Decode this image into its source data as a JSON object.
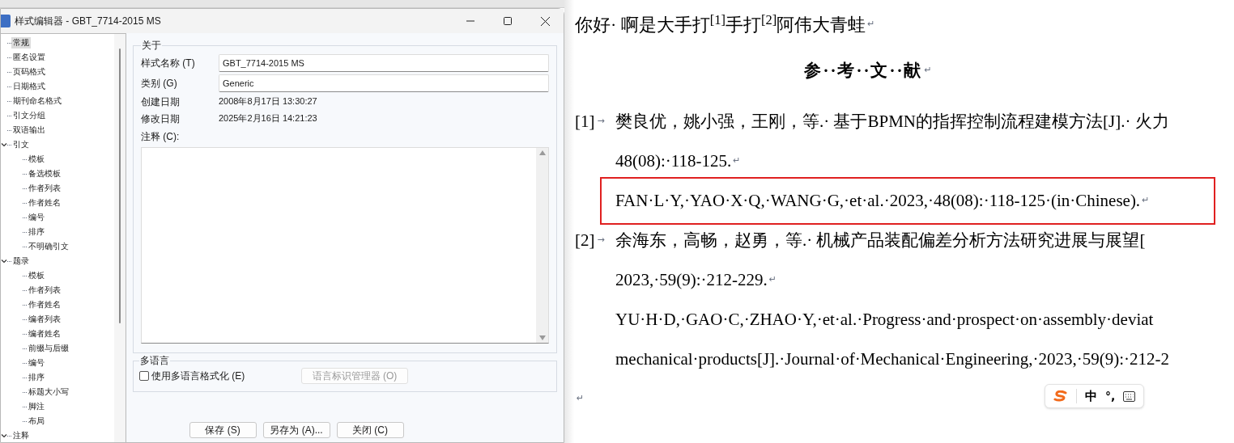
{
  "dialog": {
    "title": "样式编辑器 - GBT_7714-2015 MS",
    "tree": [
      {
        "label": "常规",
        "selected": true
      },
      {
        "label": "匿名设置",
        "selected": false
      },
      {
        "label": "页码格式",
        "selected": false
      },
      {
        "label": "日期格式",
        "selected": false
      },
      {
        "label": "期刊命名格式",
        "selected": false
      },
      {
        "label": "引文分组",
        "selected": false
      },
      {
        "label": "双语输出",
        "selected": false
      },
      {
        "label": "引文",
        "selected": false,
        "expanded": true,
        "children": [
          {
            "label": "模板",
            "selected": false
          },
          {
            "label": "备选模板",
            "selected": false
          },
          {
            "label": "作者列表",
            "selected": false
          },
          {
            "label": "作者姓名",
            "selected": false
          },
          {
            "label": "编号",
            "selected": false
          },
          {
            "label": "排序",
            "selected": false
          },
          {
            "label": "不明确引文",
            "selected": false
          }
        ]
      },
      {
        "label": "题录",
        "selected": false,
        "expanded": true,
        "children": [
          {
            "label": "模板",
            "selected": false
          },
          {
            "label": "作者列表",
            "selected": false
          },
          {
            "label": "作者姓名",
            "selected": false
          },
          {
            "label": "编者列表",
            "selected": false
          },
          {
            "label": "编者姓名",
            "selected": false
          },
          {
            "label": "前缀与后缀",
            "selected": false
          },
          {
            "label": "编号",
            "selected": false
          },
          {
            "label": "排序",
            "selected": false
          },
          {
            "label": "标题大小写",
            "selected": false
          },
          {
            "label": "脚注",
            "selected": false
          },
          {
            "label": "布局",
            "selected": false
          }
        ]
      },
      {
        "label": "注释",
        "selected": false,
        "expanded": true
      }
    ],
    "about": {
      "legend": "关于",
      "fields": [
        {
          "label": "样式名称 (T)",
          "value": "GBT_7714-2015 MS"
        },
        {
          "label": "类别 (G)",
          "value": "Generic"
        }
      ],
      "info": [
        {
          "label": "创建日期",
          "value": "2008年8月17日 13:30:27"
        },
        {
          "label": "修改日期",
          "value": "2025年2月16日 14:21:23"
        }
      ],
      "notes_label": "注释 (C):"
    },
    "multilang": {
      "legend": "多语言",
      "checkbox": {
        "label": "使用多语言格式化 (E)",
        "checked": false
      },
      "button": {
        "label": "语言标识管理器 (O)",
        "disabled": true
      }
    },
    "buttons": [
      "保存 (S)",
      "另存为 (A)...",
      "关闭 (C)"
    ]
  },
  "document": {
    "paragraphs": [
      {
        "kind": "text",
        "text": "你好· 啊是大手打$^{[1]}$手打$^{[2]}$阿伟大青蛙",
        "mark": "↵"
      },
      {
        "kind": "heading",
        "text": "参··考··文··献",
        "mark": "↵"
      },
      {
        "kind": "ref",
        "number": "[1]",
        "tab": "→",
        "lines": [
          {
            "text": "樊良优，姚小强，王刚，等.· 基于BPMN的指挥控制流程建模方法[J].· 火力",
            "highlighted": false
          },
          {
            "text": "48(08):·118-125.",
            "mark": "↵",
            "highlighted": false
          },
          {
            "text": "FAN·L·Y,·YAO·X·Q,·WANG·G,·et·al.·2023,·48(08):·118-125·(in·Chinese).",
            "mark": "↵",
            "highlighted": true
          }
        ]
      },
      {
        "kind": "ref",
        "number": "[2]",
        "tab": "→",
        "lines": [
          {
            "text": "余海东，高畅，赵勇，等.· 机械产品装配偏差分析方法研究进展与展望[",
            "highlighted": false
          },
          {
            "text": "2023,·59(9):·212-229.",
            "mark": "↵",
            "highlighted": false
          },
          {
            "text": "YU·H·D,·GAO·C,·ZHAO·Y,·et·al.·Progress·and·prospect·on·assembly·deviat",
            "highlighted": false
          },
          {
            "text": "mechanical·products[J].·Journal·of·Mechanical·Engineering,·2023,·59(9):·212-2",
            "highlighted": false
          }
        ]
      },
      {
        "kind": "empty",
        "mark": "↵"
      }
    ]
  },
  "ime": {
    "mode": "中",
    "punct": "°,"
  }
}
